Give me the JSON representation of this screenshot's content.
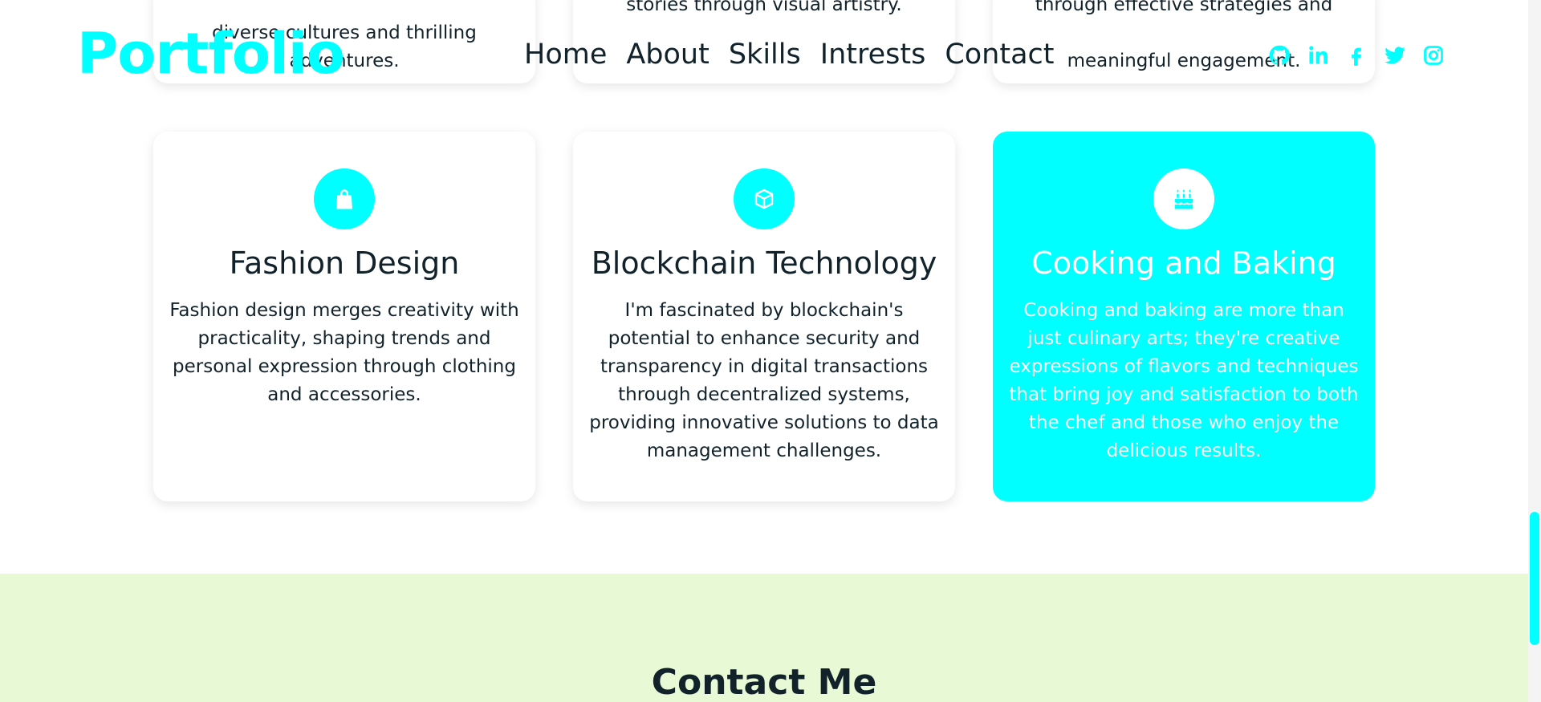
{
  "header": {
    "logo": "Portfolio",
    "nav": [
      "Home",
      "About",
      "Skills",
      "Intrests",
      "Contact"
    ],
    "social_icons": [
      "github-icon",
      "linkedin-icon",
      "facebook-icon",
      "twitter-icon",
      "instagram-icon"
    ]
  },
  "top_cards": [
    {
      "line1": "diverse cultures and thrilling",
      "line2": "adventures."
    },
    {
      "line1": "stories through visual artistry.",
      "line2": ""
    },
    {
      "line1": "through effective strategies and",
      "line2": "meaningful engagement."
    }
  ],
  "cards": [
    {
      "icon": "shopping-bag-icon",
      "title": "Fashion Design",
      "description": "Fashion design merges creativity with practicality, shaping trends and personal expression through clothing and accessories."
    },
    {
      "icon": "cube-icon",
      "title": "Blockchain Technology",
      "description": "I'm fascinated by blockchain's potential to enhance security and transparency in digital transactions through decentralized systems, providing innovative solutions to data management challenges."
    },
    {
      "icon": "cake-icon",
      "title": "Cooking and Baking",
      "description": "Cooking and baking are more than just culinary arts; they're creative expressions of flavors and techniques that bring joy and satisfaction to both the chef and those who enjoy the delicious results."
    }
  ],
  "contact": {
    "title": "Contact Me"
  },
  "colors": {
    "accent": "#00ffff",
    "text": "#12222b",
    "contact_bg": "#e8f9d6"
  }
}
